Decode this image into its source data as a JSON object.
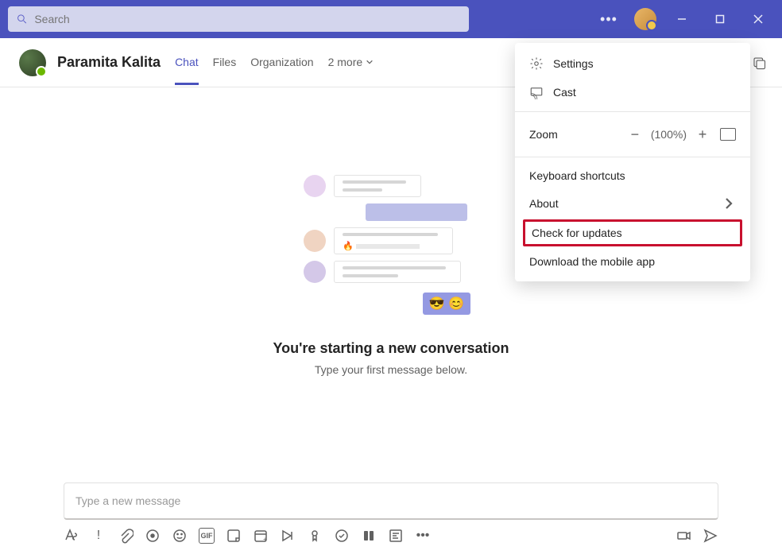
{
  "search": {
    "placeholder": "Search"
  },
  "chat": {
    "name": "Paramita Kalita",
    "tabs": {
      "chat": "Chat",
      "files": "Files",
      "org": "Organization",
      "more": "2 more"
    }
  },
  "dropdown": {
    "settings": "Settings",
    "cast": "Cast",
    "zoom_label": "Zoom",
    "zoom_pct": "(100%)",
    "shortcuts": "Keyboard shortcuts",
    "about": "About",
    "check_updates": "Check for updates",
    "download_app": "Download the mobile app"
  },
  "empty": {
    "title": "You're starting a new conversation",
    "sub": "Type your first message below."
  },
  "compose": {
    "placeholder": "Type a new message"
  }
}
